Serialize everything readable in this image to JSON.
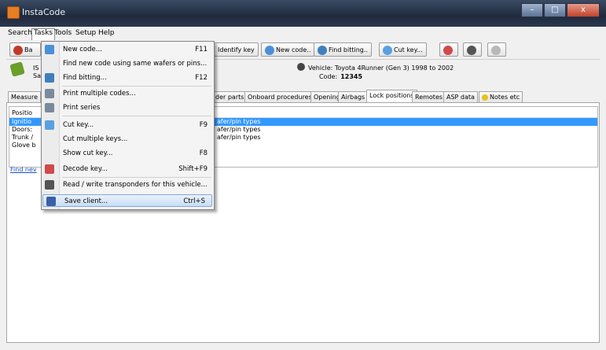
{
  "window": {
    "title": "InstaCode",
    "btn_min": "–",
    "btn_max": "□",
    "btn_close": "x"
  },
  "menubar": [
    "Search",
    "Tasks",
    "Tools",
    "Setup",
    "Help"
  ],
  "toolbar": {
    "back": "Ba",
    "identify_key": "Identify key",
    "new_code": "New code..",
    "find_bitting": "Find bitting..",
    "cut_key": "Cut key..."
  },
  "vehicle": {
    "left_line1": "IS",
    "left_line2": "Sa",
    "vehicle_label": "Vehicle: Toyota 4Runner (Gen 3) 1998 to 2002",
    "code_label": "Code:",
    "code_value": "12345"
  },
  "tabs": [
    "Measure",
    "der parts",
    "Onboard procedures",
    "Opening",
    "Airbags",
    "Lock positions",
    "Remotes",
    "ASP data",
    "Notes etc"
  ],
  "list": {
    "rows": [
      {
        "col1": "Positio",
        "col2": ""
      },
      {
        "col1": "Ignitio",
        "col2": "afer/pin types"
      },
      {
        "col1": "Doors:",
        "col2": "afer/pin types"
      },
      {
        "col1": "Trunk /",
        "col2": "afer/pin types"
      },
      {
        "col1": "Glove b",
        "col2": ""
      }
    ],
    "find_link": "Find nev"
  },
  "dropdown": {
    "items": [
      {
        "label": "New code...",
        "shortcut": "F11"
      },
      {
        "label": "Find new code using same wafers or pins...",
        "shortcut": ""
      },
      {
        "label": "Find bitting...",
        "shortcut": "F12"
      },
      {
        "label": "Print multiple codes...",
        "shortcut": ""
      },
      {
        "label": "Print series",
        "shortcut": ""
      },
      {
        "label": "Cut key...",
        "shortcut": "F9"
      },
      {
        "label": "Cut multiple keys...",
        "shortcut": ""
      },
      {
        "label": "Show cut key...",
        "shortcut": "F8"
      },
      {
        "label": "Decode key...",
        "shortcut": "Shift+F9"
      },
      {
        "label": "Read / write transponders for this vehicle...",
        "shortcut": ""
      },
      {
        "label": "Save client...",
        "shortcut": "Ctrl+S"
      }
    ]
  },
  "colors": {
    "selection": "#3399ff",
    "titlebar": "#1f2a3d",
    "menu_highlight": "#c9ddf6"
  }
}
